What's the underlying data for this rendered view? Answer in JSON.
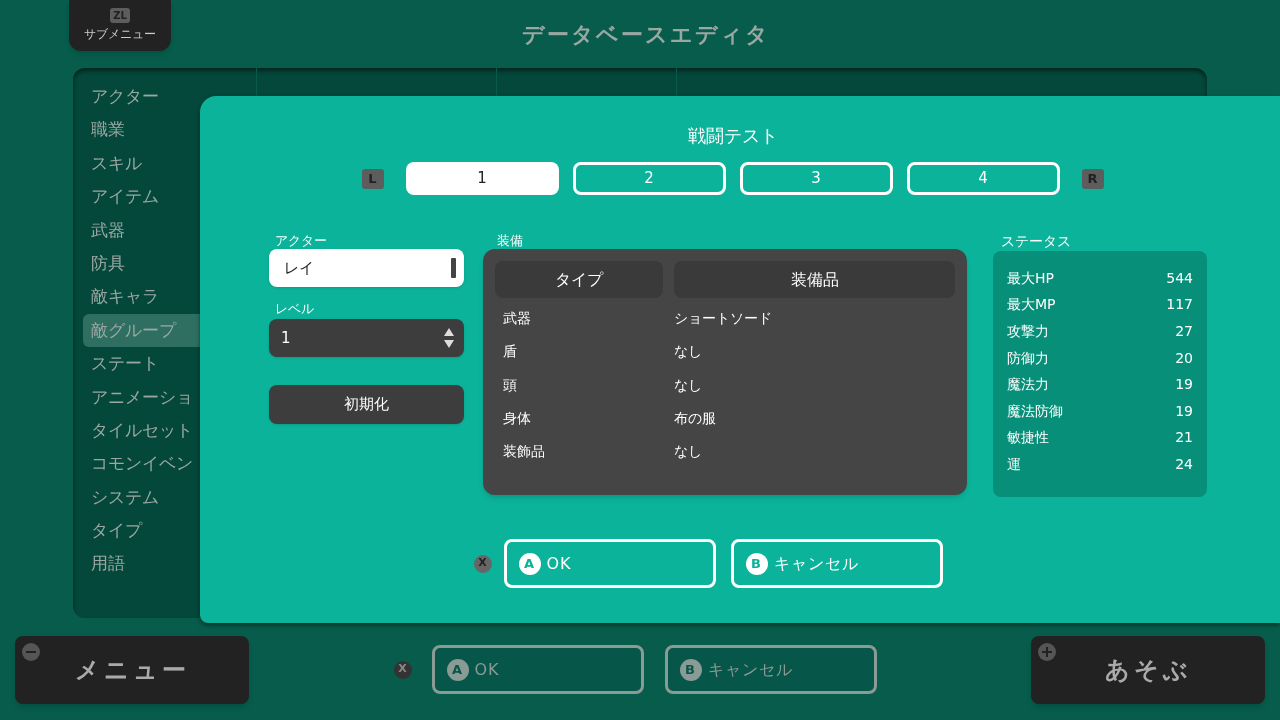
{
  "top_button": {
    "key": "ZL",
    "label": "サブメニュー"
  },
  "title": "データベースエディタ",
  "sidebar": {
    "items": [
      {
        "label": "アクター",
        "selected": false
      },
      {
        "label": "職業",
        "selected": false
      },
      {
        "label": "スキル",
        "selected": false
      },
      {
        "label": "アイテム",
        "selected": false
      },
      {
        "label": "武器",
        "selected": false
      },
      {
        "label": "防具",
        "selected": false
      },
      {
        "label": "敵キャラ",
        "selected": false
      },
      {
        "label": "敵グループ",
        "selected": true
      },
      {
        "label": "ステート",
        "selected": false
      },
      {
        "label": "アニメーショ",
        "selected": false
      },
      {
        "label": "タイルセット",
        "selected": false
      },
      {
        "label": "コモンイベン",
        "selected": false
      },
      {
        "label": "システム",
        "selected": false
      },
      {
        "label": "タイプ",
        "selected": false
      },
      {
        "label": "用語",
        "selected": false
      }
    ]
  },
  "dialog": {
    "title": "戦闘テスト",
    "prev_key": "L",
    "next_key": "R",
    "tabs": [
      {
        "label": "1",
        "selected": true
      },
      {
        "label": "2",
        "selected": false
      },
      {
        "label": "3",
        "selected": false
      },
      {
        "label": "4",
        "selected": false
      }
    ],
    "actor": {
      "label": "アクター",
      "value": "レイ"
    },
    "level": {
      "label": "レベル",
      "value": "1"
    },
    "reset_button": "初期化",
    "equipment": {
      "label": "装備",
      "columns": [
        "タイプ",
        "装備品"
      ],
      "rows": [
        [
          "武器",
          "ショートソード"
        ],
        [
          "盾",
          "なし"
        ],
        [
          "頭",
          "なし"
        ],
        [
          "身体",
          "布の服"
        ],
        [
          "装飾品",
          "なし"
        ]
      ]
    },
    "status": {
      "label": "ステータス",
      "rows": [
        {
          "name": "最大HP",
          "value": "544"
        },
        {
          "name": "最大MP",
          "value": "117"
        },
        {
          "name": "攻撃力",
          "value": "27"
        },
        {
          "name": "防御力",
          "value": "20"
        },
        {
          "name": "魔法力",
          "value": "19"
        },
        {
          "name": "魔法防御",
          "value": "19"
        },
        {
          "name": "敏捷性",
          "value": "21"
        },
        {
          "name": "運",
          "value": "24"
        }
      ]
    },
    "close_key": "X",
    "buttons": [
      {
        "key": "A",
        "label": "OK",
        "disabled": false
      },
      {
        "key": "B",
        "label": "キャンセル",
        "disabled": false
      }
    ]
  },
  "bottom_bar": {
    "menu_button": "メニュー",
    "close_key": "X",
    "buttons": [
      {
        "key": "A",
        "label": "OK",
        "disabled": true
      },
      {
        "key": "B",
        "label": "キャンセル",
        "disabled": true
      }
    ],
    "play_button": "あそぶ"
  }
}
